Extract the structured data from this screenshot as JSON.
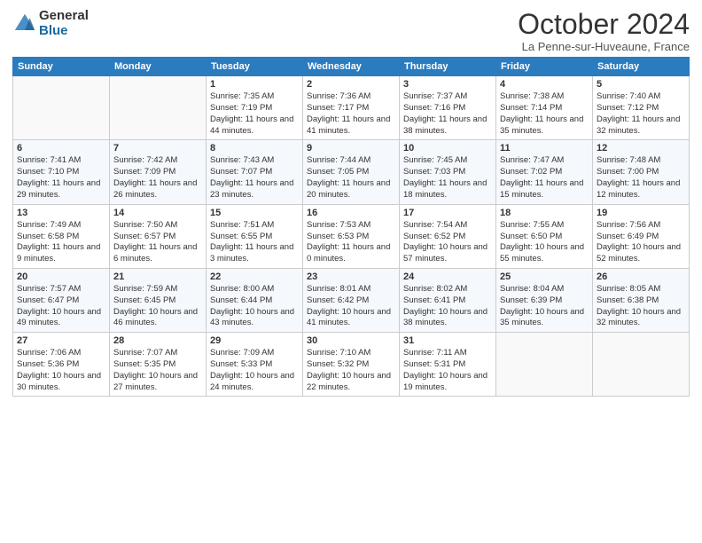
{
  "header": {
    "logo_general": "General",
    "logo_blue": "Blue",
    "title": "October 2024",
    "subtitle": "La Penne-sur-Huveaune, France"
  },
  "days_of_week": [
    "Sunday",
    "Monday",
    "Tuesday",
    "Wednesday",
    "Thursday",
    "Friday",
    "Saturday"
  ],
  "weeks": [
    [
      {
        "day": "",
        "info": ""
      },
      {
        "day": "",
        "info": ""
      },
      {
        "day": "1",
        "info": "Sunrise: 7:35 AM\nSunset: 7:19 PM\nDaylight: 11 hours and 44 minutes."
      },
      {
        "day": "2",
        "info": "Sunrise: 7:36 AM\nSunset: 7:17 PM\nDaylight: 11 hours and 41 minutes."
      },
      {
        "day": "3",
        "info": "Sunrise: 7:37 AM\nSunset: 7:16 PM\nDaylight: 11 hours and 38 minutes."
      },
      {
        "day": "4",
        "info": "Sunrise: 7:38 AM\nSunset: 7:14 PM\nDaylight: 11 hours and 35 minutes."
      },
      {
        "day": "5",
        "info": "Sunrise: 7:40 AM\nSunset: 7:12 PM\nDaylight: 11 hours and 32 minutes."
      }
    ],
    [
      {
        "day": "6",
        "info": "Sunrise: 7:41 AM\nSunset: 7:10 PM\nDaylight: 11 hours and 29 minutes."
      },
      {
        "day": "7",
        "info": "Sunrise: 7:42 AM\nSunset: 7:09 PM\nDaylight: 11 hours and 26 minutes."
      },
      {
        "day": "8",
        "info": "Sunrise: 7:43 AM\nSunset: 7:07 PM\nDaylight: 11 hours and 23 minutes."
      },
      {
        "day": "9",
        "info": "Sunrise: 7:44 AM\nSunset: 7:05 PM\nDaylight: 11 hours and 20 minutes."
      },
      {
        "day": "10",
        "info": "Sunrise: 7:45 AM\nSunset: 7:03 PM\nDaylight: 11 hours and 18 minutes."
      },
      {
        "day": "11",
        "info": "Sunrise: 7:47 AM\nSunset: 7:02 PM\nDaylight: 11 hours and 15 minutes."
      },
      {
        "day": "12",
        "info": "Sunrise: 7:48 AM\nSunset: 7:00 PM\nDaylight: 11 hours and 12 minutes."
      }
    ],
    [
      {
        "day": "13",
        "info": "Sunrise: 7:49 AM\nSunset: 6:58 PM\nDaylight: 11 hours and 9 minutes."
      },
      {
        "day": "14",
        "info": "Sunrise: 7:50 AM\nSunset: 6:57 PM\nDaylight: 11 hours and 6 minutes."
      },
      {
        "day": "15",
        "info": "Sunrise: 7:51 AM\nSunset: 6:55 PM\nDaylight: 11 hours and 3 minutes."
      },
      {
        "day": "16",
        "info": "Sunrise: 7:53 AM\nSunset: 6:53 PM\nDaylight: 11 hours and 0 minutes."
      },
      {
        "day": "17",
        "info": "Sunrise: 7:54 AM\nSunset: 6:52 PM\nDaylight: 10 hours and 57 minutes."
      },
      {
        "day": "18",
        "info": "Sunrise: 7:55 AM\nSunset: 6:50 PM\nDaylight: 10 hours and 55 minutes."
      },
      {
        "day": "19",
        "info": "Sunrise: 7:56 AM\nSunset: 6:49 PM\nDaylight: 10 hours and 52 minutes."
      }
    ],
    [
      {
        "day": "20",
        "info": "Sunrise: 7:57 AM\nSunset: 6:47 PM\nDaylight: 10 hours and 49 minutes."
      },
      {
        "day": "21",
        "info": "Sunrise: 7:59 AM\nSunset: 6:45 PM\nDaylight: 10 hours and 46 minutes."
      },
      {
        "day": "22",
        "info": "Sunrise: 8:00 AM\nSunset: 6:44 PM\nDaylight: 10 hours and 43 minutes."
      },
      {
        "day": "23",
        "info": "Sunrise: 8:01 AM\nSunset: 6:42 PM\nDaylight: 10 hours and 41 minutes."
      },
      {
        "day": "24",
        "info": "Sunrise: 8:02 AM\nSunset: 6:41 PM\nDaylight: 10 hours and 38 minutes."
      },
      {
        "day": "25",
        "info": "Sunrise: 8:04 AM\nSunset: 6:39 PM\nDaylight: 10 hours and 35 minutes."
      },
      {
        "day": "26",
        "info": "Sunrise: 8:05 AM\nSunset: 6:38 PM\nDaylight: 10 hours and 32 minutes."
      }
    ],
    [
      {
        "day": "27",
        "info": "Sunrise: 7:06 AM\nSunset: 5:36 PM\nDaylight: 10 hours and 30 minutes."
      },
      {
        "day": "28",
        "info": "Sunrise: 7:07 AM\nSunset: 5:35 PM\nDaylight: 10 hours and 27 minutes."
      },
      {
        "day": "29",
        "info": "Sunrise: 7:09 AM\nSunset: 5:33 PM\nDaylight: 10 hours and 24 minutes."
      },
      {
        "day": "30",
        "info": "Sunrise: 7:10 AM\nSunset: 5:32 PM\nDaylight: 10 hours and 22 minutes."
      },
      {
        "day": "31",
        "info": "Sunrise: 7:11 AM\nSunset: 5:31 PM\nDaylight: 10 hours and 19 minutes."
      },
      {
        "day": "",
        "info": ""
      },
      {
        "day": "",
        "info": ""
      }
    ]
  ]
}
